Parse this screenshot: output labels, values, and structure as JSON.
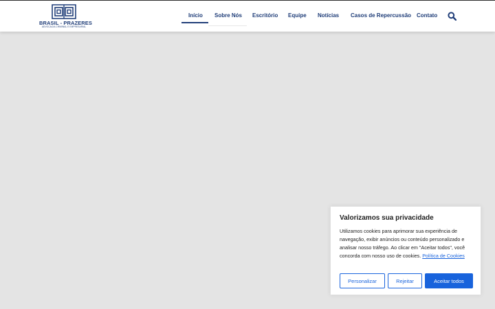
{
  "brand": {
    "name": "BRASIL - PRAZERES",
    "tagline": "ADVOCACIA CRIMINAL E EMPRESARIAL",
    "color": "#1f3d78"
  },
  "nav": {
    "items": [
      {
        "label": "Início",
        "active": true
      },
      {
        "label": "Sobre Nós"
      },
      {
        "label": "Escritório"
      },
      {
        "label": "Equipe"
      },
      {
        "label": "Notícias"
      },
      {
        "label": "Casos de Repercussão"
      },
      {
        "label": "Contato"
      }
    ],
    "search_icon": "search-icon"
  },
  "cookie_banner": {
    "title": "Valorizamos sua privacidade",
    "text": "Utilizamos cookies para aprimorar sua experiência de navegação, exibir anúncios ou conteúdo personalizado e analisar nosso tráfego. Ao clicar em \"Aceitar todos\", você concorda com nosso uso de cookies.",
    "link": "Política de Cookies",
    "buttons": {
      "customize": "Personalizar",
      "reject": "Rejeitar",
      "accept": "Aceitar todos"
    },
    "accent": "#1863dc"
  }
}
